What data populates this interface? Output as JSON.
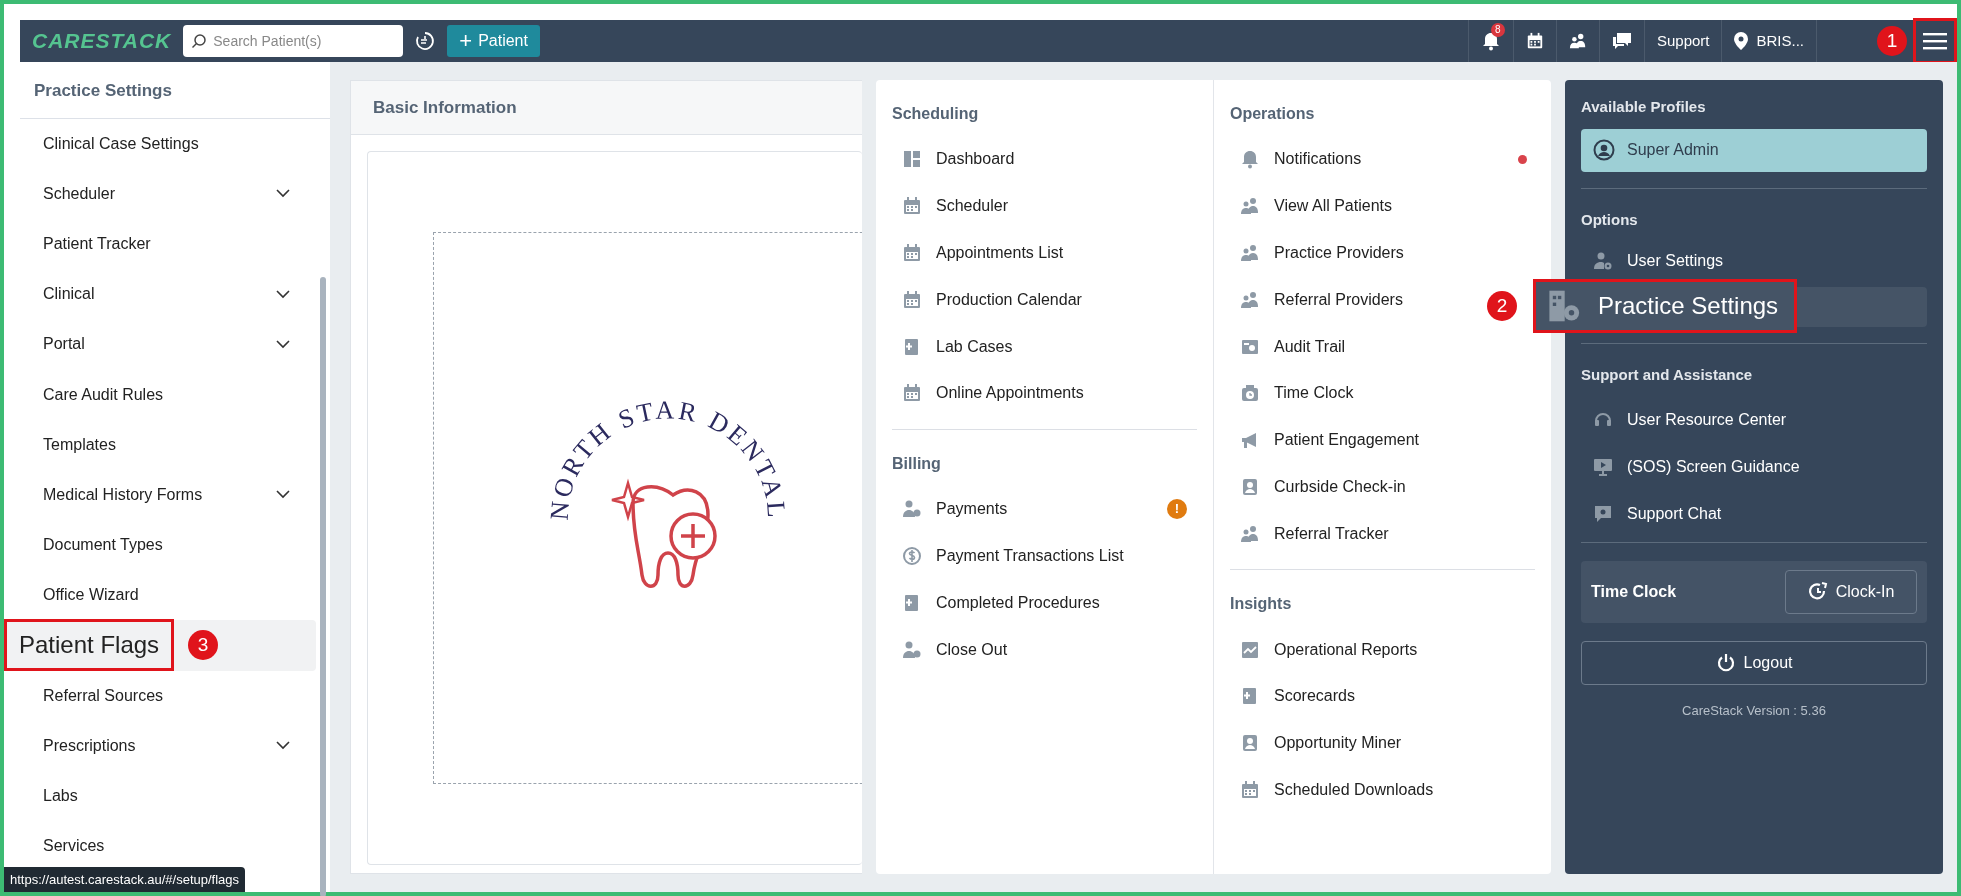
{
  "navbar": {
    "logo": "CARESTACK",
    "search": {
      "placeholder": "Search Patient(s)"
    },
    "add_button": {
      "icon": "+",
      "label": "Patient"
    },
    "notification_count": "8",
    "support": "Support",
    "location": "BRIS...",
    "menu_callout": "1"
  },
  "sidebar": {
    "title": "Practice Settings",
    "items": [
      {
        "label": "Clinical Case Settings",
        "expandable": false,
        "selected": false
      },
      {
        "label": "Scheduler",
        "expandable": true,
        "selected": false
      },
      {
        "label": "Patient Tracker",
        "expandable": false,
        "selected": false
      },
      {
        "label": "Clinical",
        "expandable": true,
        "selected": false
      },
      {
        "label": "Portal",
        "expandable": true,
        "selected": false
      },
      {
        "label": "Care Audit Rules",
        "expandable": false,
        "selected": false
      },
      {
        "label": "Templates",
        "expandable": false,
        "selected": false
      },
      {
        "label": "Medical History Forms",
        "expandable": true,
        "selected": false
      },
      {
        "label": "Document Types",
        "expandable": false,
        "selected": false
      },
      {
        "label": "Office Wizard",
        "expandable": false,
        "selected": false
      },
      {
        "label": "Patient Flags",
        "expandable": false,
        "selected": true,
        "callout": "3"
      },
      {
        "label": "Referral Sources",
        "expandable": false,
        "selected": false
      },
      {
        "label": "Prescriptions",
        "expandable": true,
        "selected": false
      },
      {
        "label": "Labs",
        "expandable": false,
        "selected": false
      },
      {
        "label": "Services",
        "expandable": false,
        "selected": false
      }
    ]
  },
  "basic_information": {
    "title": "Basic Information",
    "logo_text": "NORTH STAR DENTAL"
  },
  "menu": {
    "columns": [
      [
        {
          "heading": "Scheduling",
          "items": [
            {
              "label": "Dashboard"
            },
            {
              "label": "Scheduler"
            },
            {
              "label": "Appointments List"
            },
            {
              "label": "Production Calendar"
            },
            {
              "label": "Lab Cases"
            },
            {
              "label": "Online Appointments"
            }
          ]
        },
        {
          "heading": "Billing",
          "items": [
            {
              "label": "Payments",
              "warning": true,
              "warning_text": "!"
            },
            {
              "label": "Payment Transactions List",
              "warning": false
            },
            {
              "label": "Completed Procedures",
              "warning": false
            },
            {
              "label": "Close Out",
              "warning": false
            }
          ]
        }
      ],
      [
        {
          "heading": "Operations",
          "items": [
            {
              "label": "Notifications",
              "unread": true
            },
            {
              "label": "View All Patients",
              "unread": false
            },
            {
              "label": "Practice Providers",
              "unread": false
            },
            {
              "label": "Referral Providers",
              "unread": false
            },
            {
              "label": "Audit Trail",
              "unread": false
            },
            {
              "label": "Time Clock",
              "unread": false
            },
            {
              "label": "Patient Engagement",
              "unread": false
            },
            {
              "label": "Curbside Check-in",
              "unread": false
            },
            {
              "label": "Referral Tracker",
              "unread": false
            }
          ]
        },
        {
          "heading": "Insights",
          "items": [
            {
              "label": "Operational Reports"
            },
            {
              "label": "Scorecards"
            },
            {
              "label": "Opportunity Miner"
            },
            {
              "label": "Scheduled Downloads"
            }
          ]
        }
      ]
    ]
  },
  "profile_panel": {
    "profiles_heading": "Available Profiles",
    "profiles": [
      {
        "label": "Super Admin",
        "selected": true
      }
    ],
    "options_heading": "Options",
    "options": [
      {
        "label": "User Settings",
        "selected": false
      },
      {
        "label": "Practice Settings",
        "selected": true,
        "callout": "2"
      }
    ],
    "support_heading": "Support and Assistance",
    "support_items": [
      {
        "label": "User Resource Center"
      },
      {
        "label": "(SOS) Screen Guidance"
      },
      {
        "label": "Support Chat"
      }
    ],
    "time_clock": {
      "label": "Time Clock",
      "button": "Clock-In"
    },
    "logout": "Logout",
    "version": "CareStack Version : 5.36"
  },
  "status_url": "https://autest.carestack.au/#/setup/flags"
}
